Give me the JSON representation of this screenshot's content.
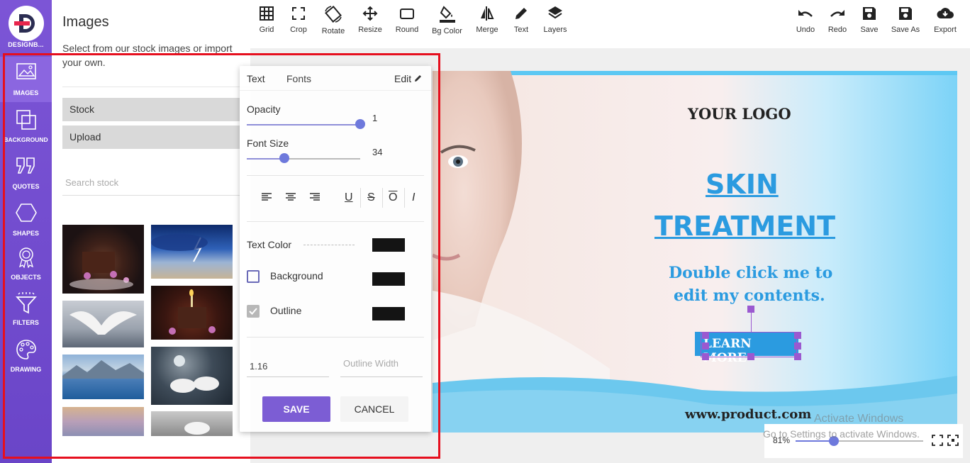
{
  "app": {
    "logo_label": "DESIGNB..."
  },
  "rail": {
    "items": [
      {
        "label": "IMAGES",
        "icon": "image-icon"
      },
      {
        "label": "BACKGROUND",
        "icon": "background-icon"
      },
      {
        "label": "QUOTES",
        "icon": "quote-icon"
      },
      {
        "label": "SHAPES",
        "icon": "hexagon-icon"
      },
      {
        "label": "OBJECTS",
        "icon": "badge-icon"
      },
      {
        "label": "FILTERS",
        "icon": "filter-icon"
      },
      {
        "label": "DRAWING",
        "icon": "palette-icon"
      }
    ]
  },
  "panel": {
    "title": "Images",
    "description": "Select from our stock images or import your own.",
    "stock_label": "Stock",
    "upload_label": "Upload",
    "search_placeholder": "Search stock"
  },
  "toolbar": {
    "left": [
      {
        "label": "Grid",
        "icon": "grid-icon"
      },
      {
        "label": "Crop",
        "icon": "crop-icon"
      },
      {
        "label": "Rotate",
        "icon": "rotate-icon"
      },
      {
        "label": "Resize",
        "icon": "resize-icon"
      },
      {
        "label": "Round",
        "icon": "round-icon"
      },
      {
        "label": "Bg Color",
        "icon": "bucket-icon"
      },
      {
        "label": "Merge",
        "icon": "merge-icon"
      },
      {
        "label": "Text",
        "icon": "pencil-icon"
      },
      {
        "label": "Layers",
        "icon": "layers-icon"
      }
    ],
    "right": [
      {
        "label": "Undo",
        "icon": "undo-icon"
      },
      {
        "label": "Redo",
        "icon": "redo-icon"
      },
      {
        "label": "Save",
        "icon": "save-icon"
      },
      {
        "label": "Save As",
        "icon": "save-as-icon"
      },
      {
        "label": "Export",
        "icon": "cloud-download-icon"
      }
    ]
  },
  "popup": {
    "tab_text": "Text",
    "tab_fonts": "Fonts",
    "edit_label": "Edit",
    "opacity_label": "Opacity",
    "opacity_value": "1",
    "font_size_label": "Font Size",
    "font_size_value": "34",
    "text_color_label": "Text Color",
    "background_label": "Background",
    "outline_label": "Outline",
    "line_height_value": "1.16",
    "outline_width_placeholder": "Outline Width",
    "save_label": "SAVE",
    "cancel_label": "CANCEL",
    "format_buttons": [
      "align-left",
      "align-center",
      "align-right",
      "underline",
      "strikethrough",
      "overline",
      "italic"
    ]
  },
  "design": {
    "logo_text": "YOUR LOGO",
    "headline_1": "SKIN",
    "headline_2": "TREATMENT",
    "body_1": "Double click me to",
    "body_2": "edit my contents.",
    "cta": "LEARN MORE",
    "website": "www.product.com"
  },
  "zoom": {
    "value": "81%"
  },
  "watermark": {
    "line1": "Activate Windows",
    "line2": "Go to Settings to activate Windows."
  },
  "colors": {
    "rail": "#7c55d6",
    "accent": "#6e79dc",
    "save_button": "#7c5dd4",
    "design_blue": "#2b9be0",
    "selection_handle": "#9b59d0"
  }
}
